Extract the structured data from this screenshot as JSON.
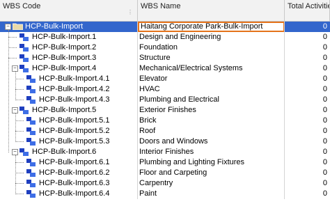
{
  "header": {
    "col_code": "WBS Code",
    "col_name": "WBS Name",
    "col_total": "Total Activities"
  },
  "rows": [
    {
      "code": "HCP-Bulk-Import",
      "name": "Haitang Corporate Park-Bulk-Import",
      "total": "0"
    },
    {
      "code": "HCP-Bulk-Import.1",
      "name": "Design and Engineering",
      "total": "0"
    },
    {
      "code": "HCP-Bulk-Import.2",
      "name": "Foundation",
      "total": "0"
    },
    {
      "code": "HCP-Bulk-Import.3",
      "name": "Structure",
      "total": "0"
    },
    {
      "code": "HCP-Bulk-Import.4",
      "name": "Mechanical/Electrical Systems",
      "total": "0"
    },
    {
      "code": "HCP-Bulk-Import.4.1",
      "name": "Elevator",
      "total": "0"
    },
    {
      "code": "HCP-Bulk-Import.4.2",
      "name": "HVAC",
      "total": "0"
    },
    {
      "code": "HCP-Bulk-Import.4.3",
      "name": "Plumbing and Electrical",
      "total": "0"
    },
    {
      "code": "HCP-Bulk-Import.5",
      "name": "Exterior Finishes",
      "total": "0"
    },
    {
      "code": "HCP-Bulk-Import.5.1",
      "name": "Brick",
      "total": "0"
    },
    {
      "code": "HCP-Bulk-Import.5.2",
      "name": "Roof",
      "total": "0"
    },
    {
      "code": "HCP-Bulk-Import.5.3",
      "name": "Doors and Windows",
      "total": "0"
    },
    {
      "code": "HCP-Bulk-Import.6",
      "name": "Interior Finishes",
      "total": "0"
    },
    {
      "code": "HCP-Bulk-Import.6.1",
      "name": "Plumbing and Lighting Fixtures",
      "total": "0"
    },
    {
      "code": "HCP-Bulk-Import.6.2",
      "name": "Floor and Carpeting",
      "total": "0"
    },
    {
      "code": "HCP-Bulk-Import.6.3",
      "name": "Carpentry",
      "total": "0"
    },
    {
      "code": "HCP-Bulk-Import.6.4",
      "name": "Paint",
      "total": "0"
    }
  ],
  "colors": {
    "selection": "#3366cc",
    "edit_border": "#e5731b",
    "wbs_icon": "#1f3fbf"
  }
}
